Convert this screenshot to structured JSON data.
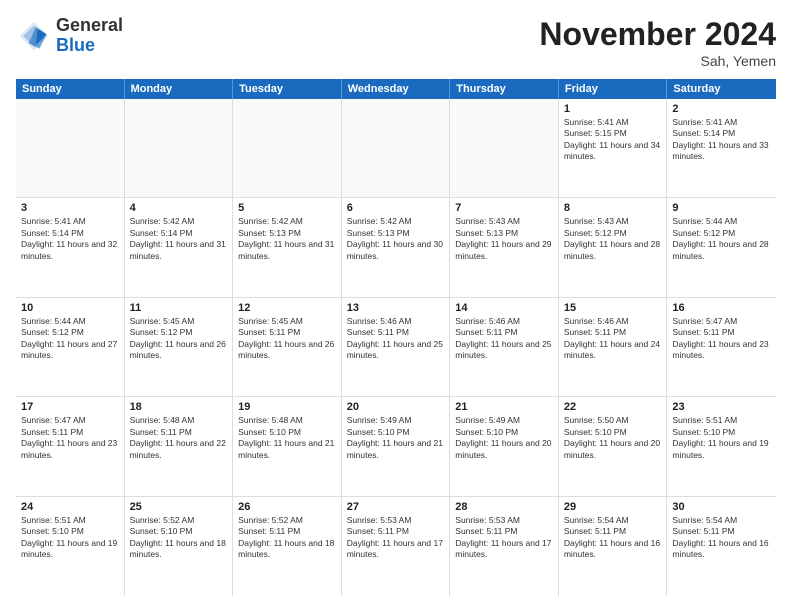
{
  "logo": {
    "general": "General",
    "blue": "Blue"
  },
  "header": {
    "month": "November 2024",
    "location": "Sah, Yemen"
  },
  "weekdays": [
    "Sunday",
    "Monday",
    "Tuesday",
    "Wednesday",
    "Thursday",
    "Friday",
    "Saturday"
  ],
  "rows": [
    [
      {
        "day": "",
        "text": ""
      },
      {
        "day": "",
        "text": ""
      },
      {
        "day": "",
        "text": ""
      },
      {
        "day": "",
        "text": ""
      },
      {
        "day": "",
        "text": ""
      },
      {
        "day": "1",
        "text": "Sunrise: 5:41 AM\nSunset: 5:15 PM\nDaylight: 11 hours and 34 minutes."
      },
      {
        "day": "2",
        "text": "Sunrise: 5:41 AM\nSunset: 5:14 PM\nDaylight: 11 hours and 33 minutes."
      }
    ],
    [
      {
        "day": "3",
        "text": "Sunrise: 5:41 AM\nSunset: 5:14 PM\nDaylight: 11 hours and 32 minutes."
      },
      {
        "day": "4",
        "text": "Sunrise: 5:42 AM\nSunset: 5:14 PM\nDaylight: 11 hours and 31 minutes."
      },
      {
        "day": "5",
        "text": "Sunrise: 5:42 AM\nSunset: 5:13 PM\nDaylight: 11 hours and 31 minutes."
      },
      {
        "day": "6",
        "text": "Sunrise: 5:42 AM\nSunset: 5:13 PM\nDaylight: 11 hours and 30 minutes."
      },
      {
        "day": "7",
        "text": "Sunrise: 5:43 AM\nSunset: 5:13 PM\nDaylight: 11 hours and 29 minutes."
      },
      {
        "day": "8",
        "text": "Sunrise: 5:43 AM\nSunset: 5:12 PM\nDaylight: 11 hours and 28 minutes."
      },
      {
        "day": "9",
        "text": "Sunrise: 5:44 AM\nSunset: 5:12 PM\nDaylight: 11 hours and 28 minutes."
      }
    ],
    [
      {
        "day": "10",
        "text": "Sunrise: 5:44 AM\nSunset: 5:12 PM\nDaylight: 11 hours and 27 minutes."
      },
      {
        "day": "11",
        "text": "Sunrise: 5:45 AM\nSunset: 5:12 PM\nDaylight: 11 hours and 26 minutes."
      },
      {
        "day": "12",
        "text": "Sunrise: 5:45 AM\nSunset: 5:11 PM\nDaylight: 11 hours and 26 minutes."
      },
      {
        "day": "13",
        "text": "Sunrise: 5:46 AM\nSunset: 5:11 PM\nDaylight: 11 hours and 25 minutes."
      },
      {
        "day": "14",
        "text": "Sunrise: 5:46 AM\nSunset: 5:11 PM\nDaylight: 11 hours and 25 minutes."
      },
      {
        "day": "15",
        "text": "Sunrise: 5:46 AM\nSunset: 5:11 PM\nDaylight: 11 hours and 24 minutes."
      },
      {
        "day": "16",
        "text": "Sunrise: 5:47 AM\nSunset: 5:11 PM\nDaylight: 11 hours and 23 minutes."
      }
    ],
    [
      {
        "day": "17",
        "text": "Sunrise: 5:47 AM\nSunset: 5:11 PM\nDaylight: 11 hours and 23 minutes."
      },
      {
        "day": "18",
        "text": "Sunrise: 5:48 AM\nSunset: 5:11 PM\nDaylight: 11 hours and 22 minutes."
      },
      {
        "day": "19",
        "text": "Sunrise: 5:48 AM\nSunset: 5:10 PM\nDaylight: 11 hours and 21 minutes."
      },
      {
        "day": "20",
        "text": "Sunrise: 5:49 AM\nSunset: 5:10 PM\nDaylight: 11 hours and 21 minutes."
      },
      {
        "day": "21",
        "text": "Sunrise: 5:49 AM\nSunset: 5:10 PM\nDaylight: 11 hours and 20 minutes."
      },
      {
        "day": "22",
        "text": "Sunrise: 5:50 AM\nSunset: 5:10 PM\nDaylight: 11 hours and 20 minutes."
      },
      {
        "day": "23",
        "text": "Sunrise: 5:51 AM\nSunset: 5:10 PM\nDaylight: 11 hours and 19 minutes."
      }
    ],
    [
      {
        "day": "24",
        "text": "Sunrise: 5:51 AM\nSunset: 5:10 PM\nDaylight: 11 hours and 19 minutes."
      },
      {
        "day": "25",
        "text": "Sunrise: 5:52 AM\nSunset: 5:10 PM\nDaylight: 11 hours and 18 minutes."
      },
      {
        "day": "26",
        "text": "Sunrise: 5:52 AM\nSunset: 5:11 PM\nDaylight: 11 hours and 18 minutes."
      },
      {
        "day": "27",
        "text": "Sunrise: 5:53 AM\nSunset: 5:11 PM\nDaylight: 11 hours and 17 minutes."
      },
      {
        "day": "28",
        "text": "Sunrise: 5:53 AM\nSunset: 5:11 PM\nDaylight: 11 hours and 17 minutes."
      },
      {
        "day": "29",
        "text": "Sunrise: 5:54 AM\nSunset: 5:11 PM\nDaylight: 11 hours and 16 minutes."
      },
      {
        "day": "30",
        "text": "Sunrise: 5:54 AM\nSunset: 5:11 PM\nDaylight: 11 hours and 16 minutes."
      }
    ]
  ]
}
